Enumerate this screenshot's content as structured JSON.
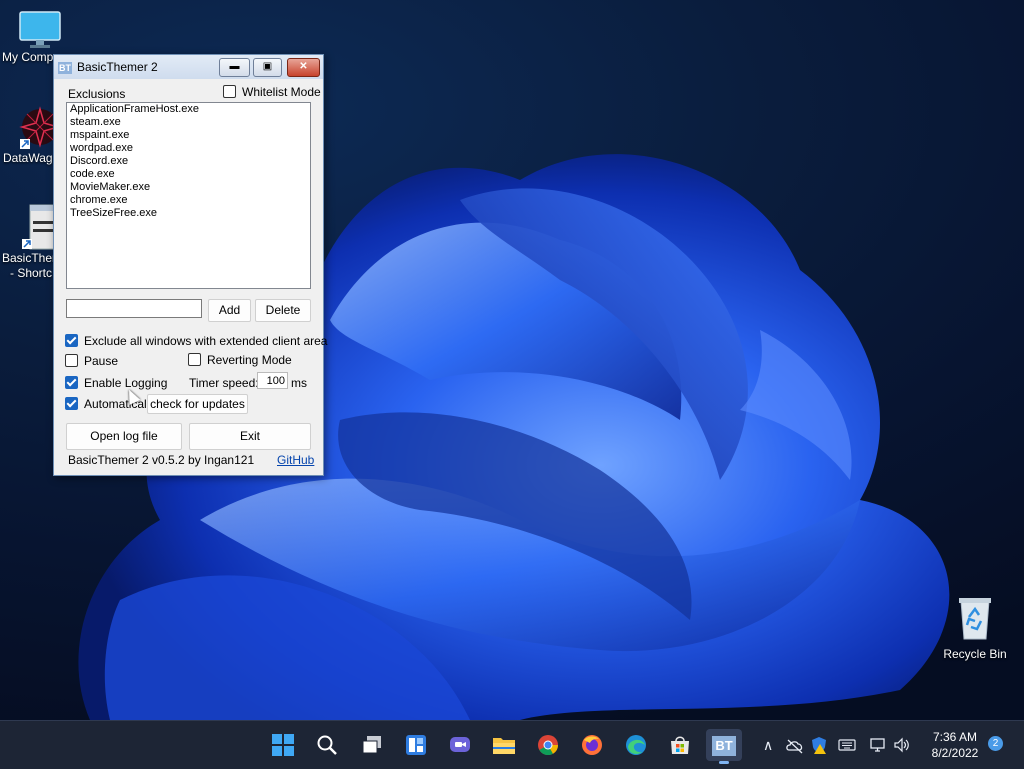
{
  "desktop": {
    "icons": [
      {
        "label": "My Comp"
      },
      {
        "label": "DataWag"
      },
      {
        "label": "BasicTher",
        "label2": "- Shortc"
      },
      {
        "label": "Recycle Bin"
      }
    ]
  },
  "window": {
    "title": "BasicThemer 2",
    "app_icon_text": "BT",
    "exclusions_label": "Exclusions",
    "whitelist_label": "Whitelist Mode",
    "whitelist_checked": false,
    "exclusions": [
      "ApplicationFrameHost.exe",
      "steam.exe",
      "mspaint.exe",
      "wordpad.exe",
      "Discord.exe",
      "code.exe",
      "MovieMaker.exe",
      "chrome.exe",
      "TreeSizeFree.exe"
    ],
    "new_exclusion_value": "",
    "add_label": "Add",
    "delete_label": "Delete",
    "exclude_extended_label": "Exclude all windows with extended client area",
    "exclude_extended_checked": true,
    "pause_label": "Pause",
    "pause_checked": false,
    "reverting_label": "Reverting Mode",
    "reverting_checked": false,
    "logging_label": "Enable Logging",
    "logging_checked": true,
    "timer_label": "Timer speed:",
    "timer_value": "100",
    "timer_unit": "ms",
    "auto_label": "Automatically",
    "auto_checked": true,
    "check_updates_label": "check for updates",
    "open_log_label": "Open log file",
    "exit_label": "Exit",
    "version_label": "BasicThemer 2 v0.5.2 by Ingan121",
    "github_label": "GitHub"
  },
  "taskbar": {
    "app_icon_text": "BT",
    "time": "7:36 AM",
    "date": "8/2/2022",
    "notification_count": "2"
  },
  "colors": {
    "accent": "#1a66c2",
    "taskbar": "#1d2535",
    "wallpaper_blue": "#1f4fd8"
  }
}
